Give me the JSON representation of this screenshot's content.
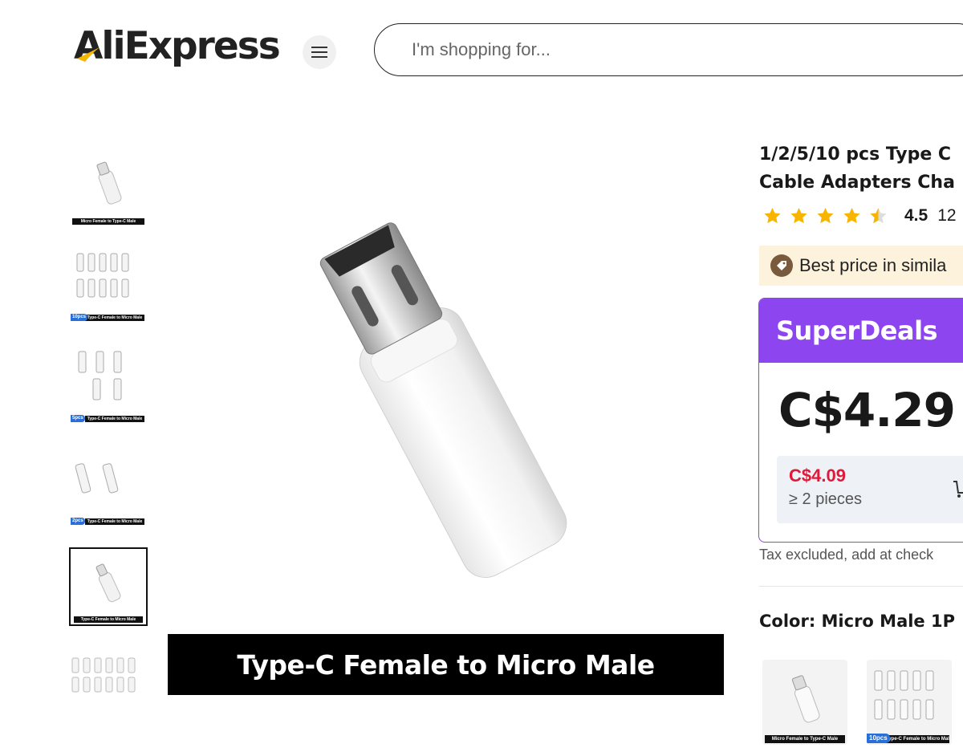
{
  "header": {
    "logo_text": "AliExpress",
    "menu_icon": "hamburger-icon",
    "search_placeholder": "I'm shopping for..."
  },
  "thumbnails": [
    {
      "caption": "Micro Female to Type-C Male",
      "qty": "",
      "selected": false
    },
    {
      "caption": "Type-C Female to Micro Male",
      "qty": "10pcs",
      "selected": false
    },
    {
      "caption": "Type-C Female to Micro Male",
      "qty": "5pcs",
      "selected": false
    },
    {
      "caption": "Type-C Female to Micro Male",
      "qty": "2pcs",
      "selected": false
    },
    {
      "caption": "Type-C Female to Micro Male",
      "qty": "",
      "selected": true
    },
    {
      "caption": "",
      "qty": "",
      "selected": false
    }
  ],
  "main_image": {
    "caption": "Type-C Female to Micro Male"
  },
  "product": {
    "title_line1": "1/2/5/10 pcs Type C",
    "title_line2": "Cable Adapters Cha",
    "rating": 4.5,
    "rating_value_text": "4.5",
    "rating_count_text": "12",
    "best_price_text": "Best price in simila",
    "deal_label": "SuperDeals",
    "price": "C$4.29",
    "tier_price": "C$4.09",
    "tier_qty": "≥ 2 pieces",
    "tax_note": "Tax excluded, add at check",
    "color_label": "Color: Micro Male 1P",
    "swatches": [
      {
        "caption": "Micro Female to Type-C Male",
        "qty": ""
      },
      {
        "caption": "Type-C Female to Micro Male",
        "qty": "10pcs"
      }
    ]
  },
  "colors": {
    "accent_purple": "#8d46ef",
    "tier_price_red": "#e0193b",
    "star_gold": "#f7b500",
    "best_price_bg": "#fdf3dd"
  }
}
